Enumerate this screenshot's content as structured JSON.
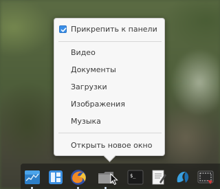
{
  "menu": {
    "pin_label": "Прикрепить к панели",
    "pin_checked": true,
    "places": [
      "Видео",
      "Документы",
      "Загрузки",
      "Изображения",
      "Музыка"
    ],
    "open_new_window": "Открыть новое окно"
  },
  "dock": {
    "icons": [
      {
        "name": "system-monitor-icon",
        "color": "#2d8fd8"
      },
      {
        "name": "workspace-switcher-icon",
        "color": "#3b8fe0"
      },
      {
        "name": "firefox-icon",
        "color": "#e8732a"
      },
      {
        "name": "files-icon",
        "color": "#8a8a8a"
      },
      {
        "name": "terminal-icon",
        "color": "#222222"
      },
      {
        "name": "text-editor-icon",
        "color": "#eeeeee"
      },
      {
        "name": "app-store-icon",
        "color": "#3aa0e0"
      },
      {
        "name": "screenshot-icon",
        "color": "#333333"
      }
    ]
  },
  "colors": {
    "accent": "#3a8ee6"
  }
}
